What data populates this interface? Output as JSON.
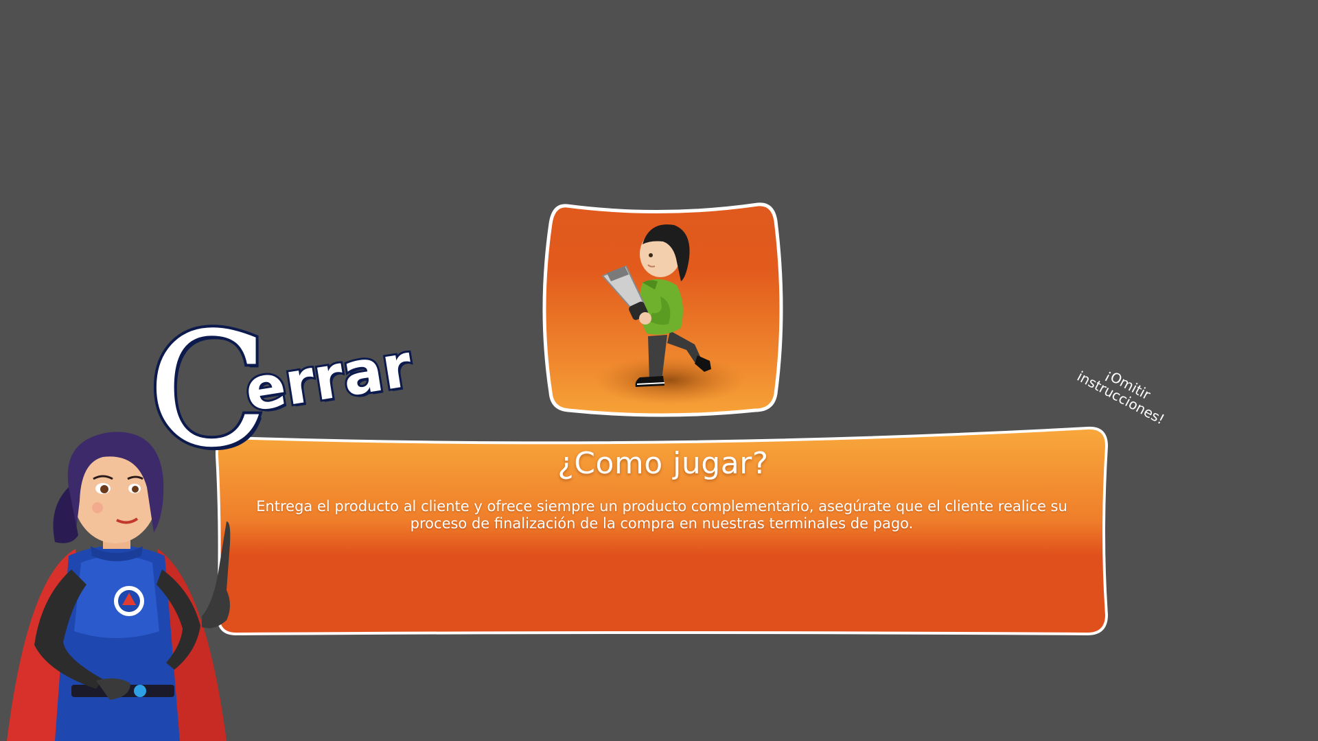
{
  "game": {
    "close_label_first": "C",
    "close_label_rest": "errar",
    "skip_label_line1": "¡Omitir",
    "skip_label_line2": "instrucciones!",
    "panel_title": "¿Como jugar?",
    "panel_body": "Entrega el producto al cliente y ofrece siempre un producto complementario, asegúrate que el cliente realice su proceso de finalización de la compra en nuestras terminales de pago."
  },
  "icons": {
    "player_illustration": "running-character-with-blender",
    "mascot": "superhero-woman-mascot",
    "emblem": "mascot-chest-emblem"
  },
  "colors": {
    "background": "#505050",
    "panel_orange_top": "#f7a53c",
    "panel_orange_bottom": "#e0501c",
    "outline_white": "#ffffff",
    "close_outline_navy": "#0c1a4d"
  }
}
